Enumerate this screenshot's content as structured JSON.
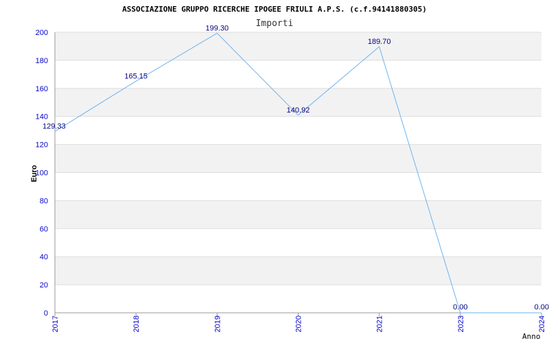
{
  "chart_data": {
    "type": "line",
    "title": "ASSOCIAZIONE GRUPPO RICERCHE IPOGEE FRIULI A.P.S. (c.f.94141880305)",
    "subtitle": "Importi",
    "xlabel": "Anno",
    "ylabel": "Euro",
    "categories": [
      "2017",
      "2018",
      "2019",
      "2020",
      "2021",
      "2023",
      "2024"
    ],
    "series": [
      {
        "values": [
          129.33,
          165.15,
          199.3,
          140.92,
          189.7,
          0.0,
          0.0
        ],
        "labels": [
          "129.33",
          "165.15",
          "199.30",
          "140.92",
          "189.70",
          "0.00",
          "0.00"
        ]
      }
    ],
    "ylim": [
      0,
      200
    ],
    "yticks": [
      0,
      20,
      40,
      60,
      80,
      100,
      120,
      140,
      160,
      180,
      200
    ],
    "grid": true,
    "colors": {
      "line": "#6fb3f0",
      "band": "#f2f2f2",
      "grid": "#dddddd",
      "tick": "#0000cc",
      "label": "#000080"
    }
  }
}
